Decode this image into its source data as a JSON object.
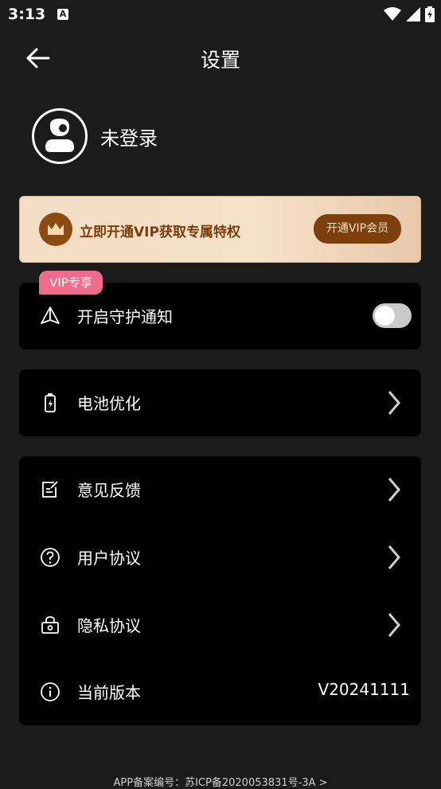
{
  "status": {
    "time": "3:13"
  },
  "header": {
    "title": "设置"
  },
  "profile": {
    "login_text": "未登录"
  },
  "vip_banner": {
    "text": "立即开通VIP获取专属特权",
    "button_label": "开通VIP会员"
  },
  "vip_badge": "VIP专享",
  "rows": {
    "guard_notify": {
      "label": "开启守护通知",
      "toggle_on": false
    },
    "battery": {
      "label": "电池优化"
    },
    "feedback": {
      "label": "意见反馈"
    },
    "user_agreement": {
      "label": "用户协议"
    },
    "privacy": {
      "label": "隐私协议"
    },
    "version": {
      "label": "当前版本",
      "value": "V20241111"
    }
  },
  "footer": {
    "text": "APP备案编号：苏ICP备2020053831号-3A >"
  },
  "colors": {
    "background": "#1b1b1b",
    "card": "#000000",
    "vip_brown": "#7d3f0b",
    "badge_pink": "#f36b8a"
  }
}
